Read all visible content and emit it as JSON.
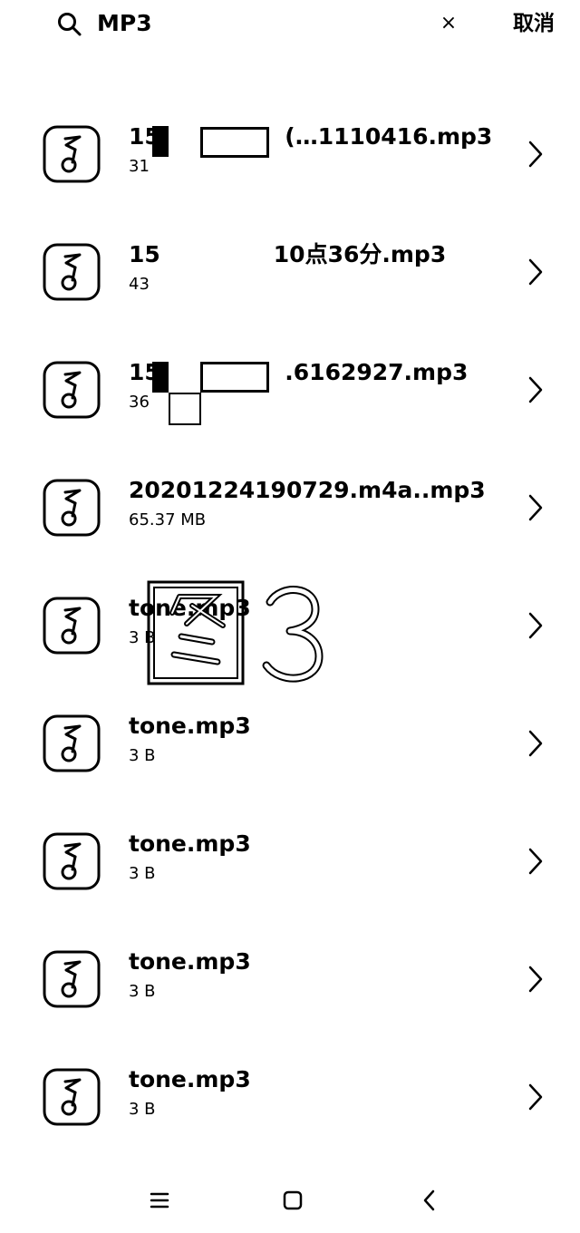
{
  "search": {
    "query": "MP3",
    "cancel_label": "取消",
    "clear_glyph": "×"
  },
  "files": [
    {
      "name": "15           (…1110416.mp3",
      "size": "31",
      "icon": "music-note-icon"
    },
    {
      "name": "15          10点36分.mp3",
      "size": "43",
      "icon": "music-note-icon"
    },
    {
      "name": "15           .6162927.mp3",
      "size": "36",
      "icon": "music-note-icon"
    },
    {
      "name": "20201224190729.m4a..mp3",
      "size": "65.37 MB",
      "icon": "music-note-icon"
    },
    {
      "name": "tone.mp3",
      "size": "3 B",
      "icon": "music-note-icon"
    },
    {
      "name": "tone.mp3",
      "size": "3 B",
      "icon": "music-note-icon"
    },
    {
      "name": "tone.mp3",
      "size": "3 B",
      "icon": "music-note-icon"
    },
    {
      "name": "tone.mp3",
      "size": "3 B",
      "icon": "music-note-icon"
    },
    {
      "name": "tone.mp3",
      "size": "3 B",
      "icon": "music-note-icon"
    }
  ],
  "watermark": {
    "text": "图3"
  },
  "navigation": {
    "menu_icon": "menu-icon",
    "home_icon": "home-icon",
    "back_icon": "back-icon"
  },
  "colors": {
    "foreground": "#000000",
    "background": "#ffffff"
  }
}
